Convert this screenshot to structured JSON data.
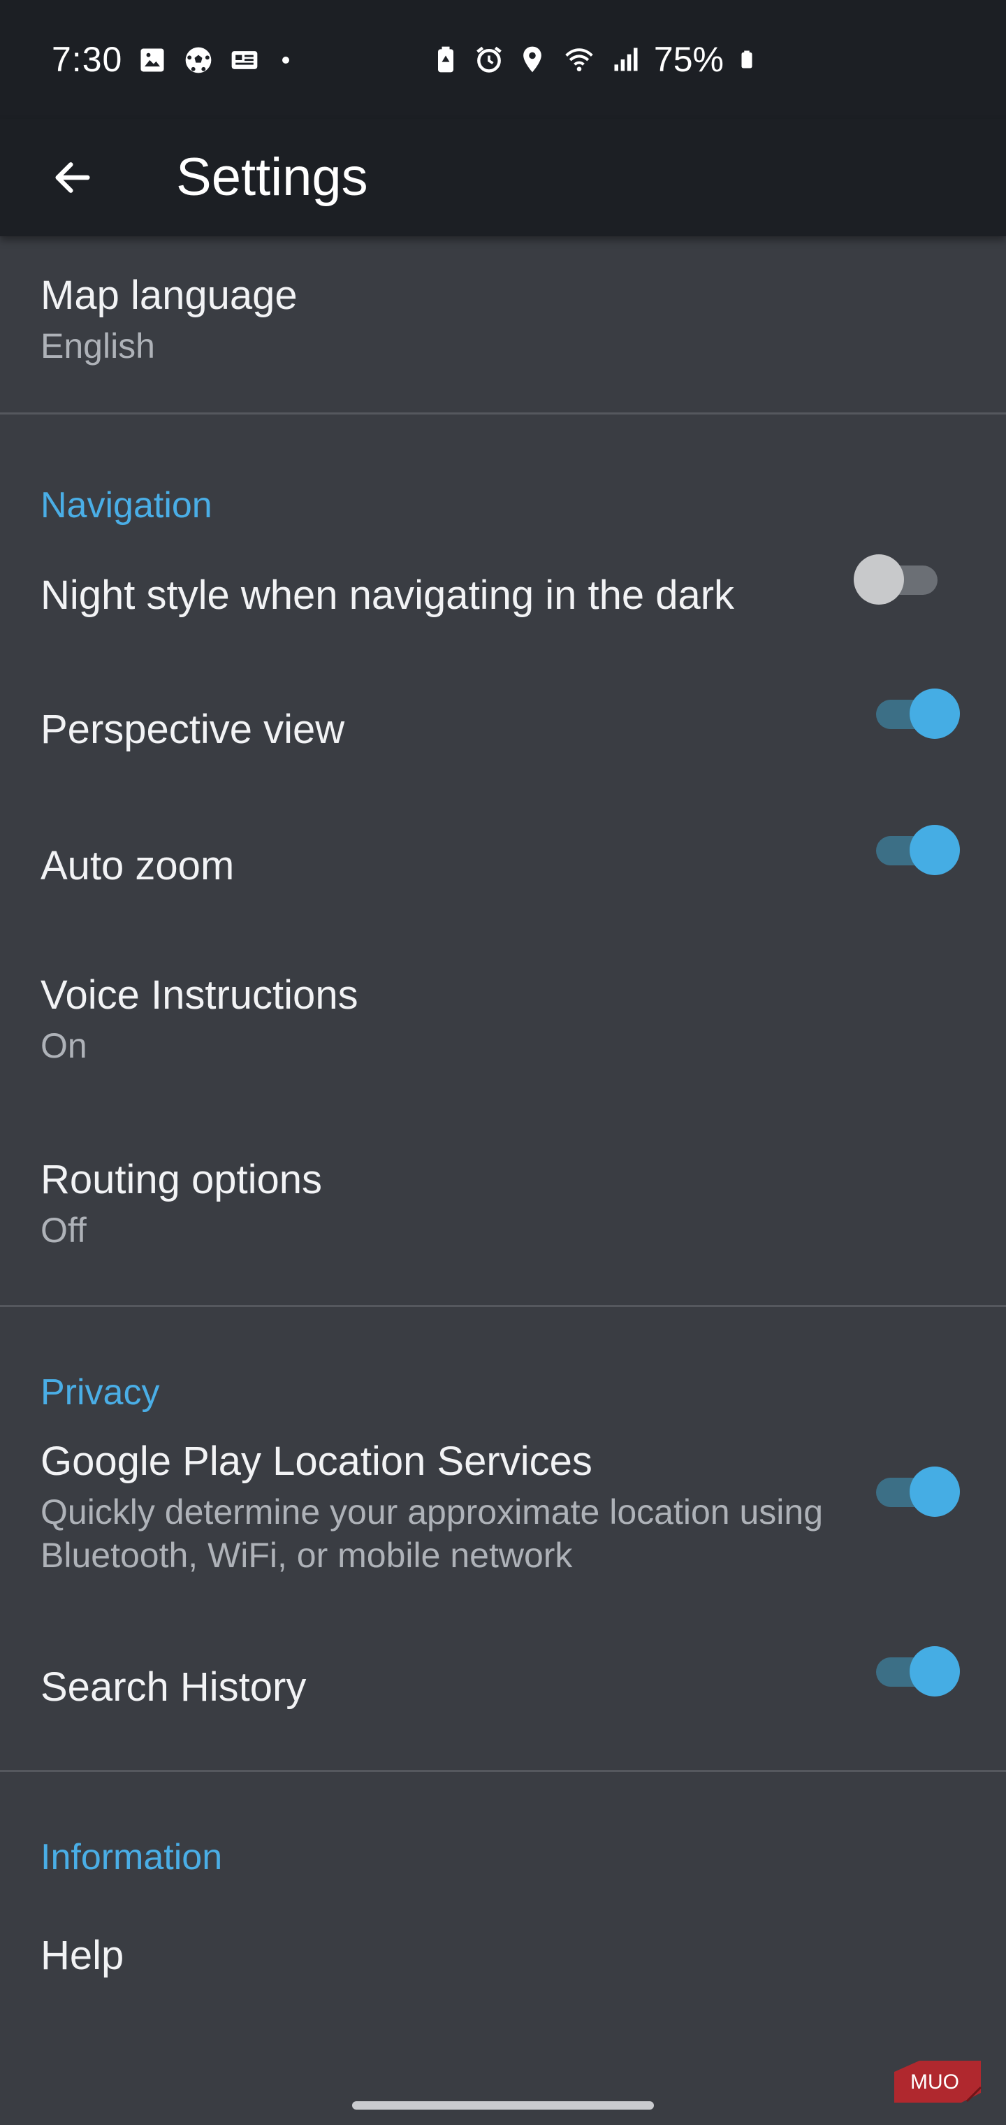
{
  "status_bar": {
    "time": "7:30",
    "battery_percent": "75%",
    "left_icons": [
      "image-icon",
      "soccer-ball-icon",
      "news-icon",
      "dot-icon"
    ],
    "right_icons": [
      "battery-saver-icon",
      "alarm-icon",
      "location-pin-icon",
      "wifi-icon",
      "signal-icon",
      "battery-icon"
    ]
  },
  "app_bar": {
    "title": "Settings",
    "back_icon": "arrow-left-icon"
  },
  "settings": {
    "map_language": {
      "title": "Map language",
      "value": "English"
    },
    "navigation": {
      "header": "Navigation",
      "night_style": {
        "title": "Night style when navigating in the dark",
        "enabled": false
      },
      "perspective_view": {
        "title": "Perspective view",
        "enabled": true
      },
      "auto_zoom": {
        "title": "Auto zoom",
        "enabled": true
      },
      "voice_instructions": {
        "title": "Voice Instructions",
        "value": "On"
      },
      "routing_options": {
        "title": "Routing options",
        "value": "Off"
      }
    },
    "privacy": {
      "header": "Privacy",
      "location_services": {
        "title": "Google Play Location Services",
        "description": "Quickly determine your approximate location using Bluetooth, WiFi, or mobile network",
        "enabled": true
      },
      "search_history": {
        "title": "Search History",
        "enabled": true
      }
    },
    "information": {
      "header": "Information",
      "help": {
        "title": "Help"
      }
    }
  },
  "watermark": "MUO",
  "colors": {
    "background": "#3a3d43",
    "bar": "#1c1f24",
    "accent": "#45ade4",
    "section_header": "#4aaee6",
    "divider": "#55585e"
  }
}
